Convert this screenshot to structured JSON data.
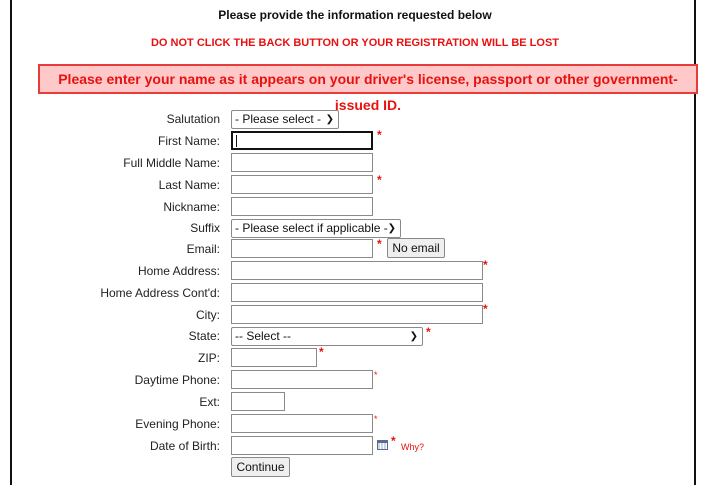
{
  "header": {
    "intro": "Please provide the information requested below",
    "back_warning": "DO NOT CLICK THE BACK BUTTON OR YOUR REGISTRATION WILL BE LOST",
    "name_notice": "Please enter your name as it appears on your driver's license, passport or other government-issued ID."
  },
  "form": {
    "salutation": {
      "label": "Salutation",
      "selected": "- Please select -"
    },
    "first_name": {
      "label": "First Name:",
      "value": ""
    },
    "middle_name": {
      "label": "Full Middle Name:",
      "value": ""
    },
    "last_name": {
      "label": "Last Name:",
      "value": ""
    },
    "nickname": {
      "label": "Nickname:",
      "value": ""
    },
    "suffix": {
      "label": "Suffix",
      "selected": "- Please select if applicable -"
    },
    "email": {
      "label": "Email:",
      "value": "",
      "no_email_button": "No email"
    },
    "home_address": {
      "label": "Home Address:",
      "value": ""
    },
    "home_address2": {
      "label": "Home Address Cont'd:",
      "value": ""
    },
    "city": {
      "label": "City:",
      "value": ""
    },
    "state": {
      "label": "State:",
      "selected": "-- Select --"
    },
    "zip": {
      "label": "ZIP:",
      "value": ""
    },
    "daytime_phone": {
      "label": "Daytime Phone:",
      "value": ""
    },
    "ext": {
      "label": "Ext:",
      "value": ""
    },
    "evening_phone": {
      "label": "Evening Phone:",
      "value": ""
    },
    "dob": {
      "label": "Date of Birth:",
      "value": "",
      "why_link": "Why?"
    },
    "required_marker": "*",
    "continue_button": "Continue"
  },
  "icons": {
    "dropdown": "chevron-down-icon",
    "calendar": "calendar-icon"
  },
  "colors": {
    "alert_red": "#e8110f",
    "alert_bg": "#ffc9c9",
    "alert_border": "#e83b3b"
  }
}
